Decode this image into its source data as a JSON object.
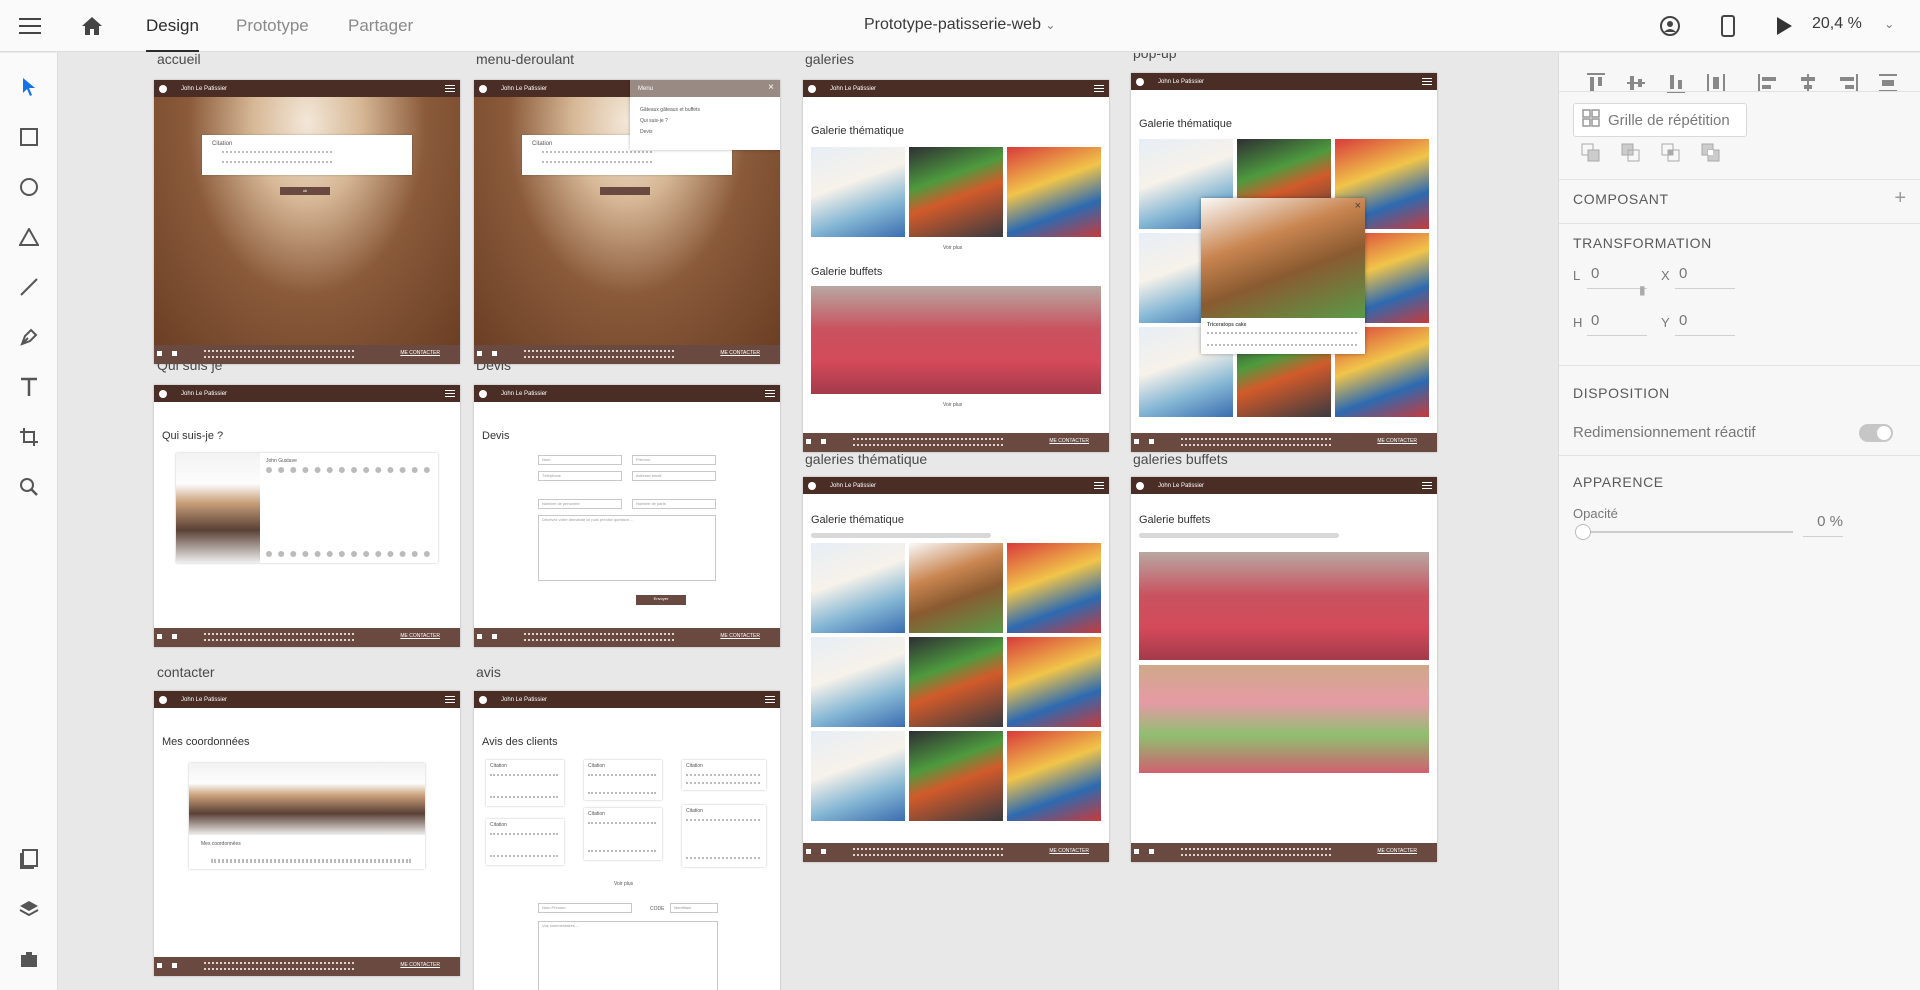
{
  "app": {
    "tabs": [
      "Design",
      "Prototype",
      "Partager"
    ],
    "doc_title": "Prototype-patisserie-web",
    "zoom": "20,4 %"
  },
  "artboards": {
    "labels": [
      "accueil",
      "menu-deroulant",
      "galeries",
      "pop-up",
      "Qui suis je",
      "Devis",
      "galeries thématique",
      "galeries buffets",
      "contacter",
      "avis"
    ],
    "brand": "John Le Patissier",
    "footer_cta": "ME CONTACTER",
    "accueil": {
      "quote_title": "Citation",
      "button": "ok"
    },
    "menu": {
      "title": "Menu",
      "items": [
        "Gâteaux gâteaux et buffets",
        "Qui suis-je ?",
        "Devis"
      ]
    },
    "galeries": {
      "section1": "Galerie thématique",
      "section2": "Galerie buffets",
      "more": "Voir plus"
    },
    "popup": {
      "section": "Galerie thématique",
      "caption": "Triceratops cake"
    },
    "qui": {
      "title": "Qui suis-je ?",
      "name": "John Gustave"
    },
    "devis": {
      "title": "Devis",
      "fields": [
        "Nom",
        "Prénom",
        "Téléphone",
        "Adresse email",
        "Nombre de personne",
        "Nombre de parts"
      ],
      "textarea": "Décrivez votre demande ici puis précise question ...",
      "submit": "Envoyer"
    },
    "contact": {
      "title": "Mes coordonnées",
      "subtitle": "Mes coordonnées"
    },
    "avis": {
      "title": "Avis des clients",
      "card_title": "Citation",
      "more": "Voir plus",
      "field_name": "Nom Prénom",
      "field_code": "CODE",
      "field_id": "Identifiant",
      "comment": "Vos commentaires ..."
    },
    "gal_them": {
      "title": "Galerie thématique"
    },
    "gal_buff": {
      "title": "Galerie buffets"
    }
  },
  "right_panel": {
    "repeat_grid": "Grille de répétition",
    "component": "COMPOSANT",
    "transformation": "TRANSFORMATION",
    "fields": {
      "L": "0",
      "X": "0",
      "H": "0",
      "Y": "0"
    },
    "disposition": "DISPOSITION",
    "responsive": "Redimensionnement réactif",
    "appearance": "APPARENCE",
    "opacity_label": "Opacité",
    "opacity_value": "0 %"
  },
  "colors": {
    "brown_dark": "#4a2e25",
    "brown_footer": "#6a4a40",
    "accent": "#1473e6"
  }
}
